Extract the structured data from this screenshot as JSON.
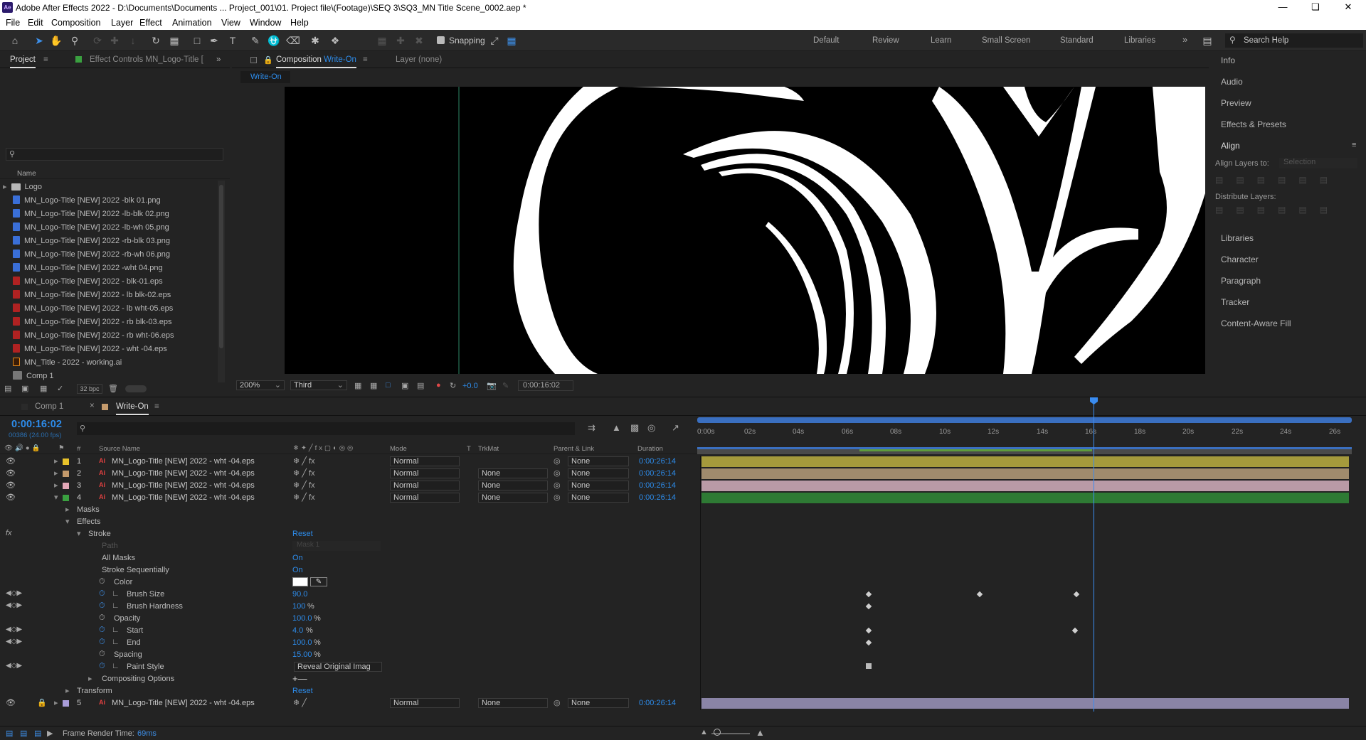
{
  "app": {
    "title": "Adobe After Effects 2022 - D:\\Documents\\Documents ... Project_001\\01. Project file\\(Footage)\\SEQ 3\\SQ3_MN Title Scene_0002.aep *",
    "icon": "Ae"
  },
  "menu": [
    "File",
    "Edit",
    "Composition",
    "Layer",
    "Effect",
    "Animation",
    "View",
    "Window",
    "Help"
  ],
  "toolbar": {
    "snapping": "Snapping",
    "workspaces": [
      "Default",
      "Review",
      "Learn",
      "Small Screen",
      "Standard",
      "Libraries"
    ],
    "search_placeholder": "Search Help",
    "more": "»"
  },
  "project": {
    "tab": "Project",
    "effect_controls_tab": "Effect Controls MN_Logo-Title [",
    "col_name": "Name",
    "bpc": "32 bpc",
    "items": [
      {
        "name": "Logo",
        "type": "folder"
      },
      {
        "name": "MN_Logo-Title [NEW] 2022 -blk 01.png",
        "type": "png"
      },
      {
        "name": "MN_Logo-Title [NEW] 2022 -lb-blk 02.png",
        "type": "png"
      },
      {
        "name": "MN_Logo-Title [NEW] 2022 -lb-wh 05.png",
        "type": "png"
      },
      {
        "name": "MN_Logo-Title [NEW] 2022 -rb-blk 03.png",
        "type": "png"
      },
      {
        "name": "MN_Logo-Title [NEW] 2022 -rb-wh 06.png",
        "type": "png"
      },
      {
        "name": "MN_Logo-Title [NEW] 2022 -wht 04.png",
        "type": "png"
      },
      {
        "name": "MN_Logo-Title [NEW] 2022 - blk-01.eps",
        "type": "eps"
      },
      {
        "name": "MN_Logo-Title [NEW] 2022 - lb blk-02.eps",
        "type": "eps"
      },
      {
        "name": "MN_Logo-Title [NEW] 2022 - lb wht-05.eps",
        "type": "eps"
      },
      {
        "name": "MN_Logo-Title [NEW] 2022 - rb blk-03.eps",
        "type": "eps"
      },
      {
        "name": "MN_Logo-Title [NEW] 2022 - rb wht-06.eps",
        "type": "eps"
      },
      {
        "name": "MN_Logo-Title [NEW] 2022 - wht -04.eps",
        "type": "eps"
      },
      {
        "name": "MN_Title - 2022 - working.ai",
        "type": "ai"
      },
      {
        "name": "Comp 1",
        "type": "comp"
      }
    ]
  },
  "composition": {
    "tab_prefix": "Composition",
    "tab_name": "Write-On",
    "layer_tab": "Layer (none)",
    "breadcrumb": "Write-On",
    "zoom": "200%",
    "resolution": "Third",
    "exposure": "+0.0",
    "timecode": "0:00:16:02"
  },
  "right_panels": [
    "Info",
    "Audio",
    "Preview",
    "Effects & Presets",
    "Align",
    "Libraries",
    "Character",
    "Paragraph",
    "Tracker",
    "Content-Aware Fill"
  ],
  "align": {
    "align_layers_to": "Align Layers to:",
    "selection": "Selection",
    "distribute": "Distribute Layers:"
  },
  "timeline": {
    "tabs": [
      "Comp 1",
      "Write-On"
    ],
    "timecode": "0:00:16:02",
    "fps": "00386 (24.00 fps)",
    "columns": {
      "num": "#",
      "source": "Source Name",
      "mode": "Mode",
      "t": "T",
      "trkmat": "TrkMat",
      "parent": "Parent & Link",
      "duration": "Duration"
    },
    "ruler": [
      "0:00s",
      "02s",
      "04s",
      "06s",
      "08s",
      "10s",
      "12s",
      "14s",
      "16s",
      "18s",
      "20s",
      "22s",
      "24s",
      "26s"
    ],
    "layers": [
      {
        "num": "1",
        "name": "MN_Logo-Title [NEW] 2022 - wht -04.eps",
        "mode": "Normal",
        "trkmat": "",
        "parent": "None",
        "duration": "0:00:26:14",
        "label": "#e8c22a"
      },
      {
        "num": "2",
        "name": "MN_Logo-Title [NEW] 2022 - wht -04.eps",
        "mode": "Normal",
        "trkmat": "None",
        "parent": "None",
        "duration": "0:00:26:14",
        "label": "#c49a6c"
      },
      {
        "num": "3",
        "name": "MN_Logo-Title [NEW] 2022 - wht -04.eps",
        "mode": "Normal",
        "trkmat": "None",
        "parent": "None",
        "duration": "0:00:26:14",
        "label": "#e4a8b8"
      },
      {
        "num": "4",
        "name": "MN_Logo-Title [NEW] 2022 - wht -04.eps",
        "mode": "Normal",
        "trkmat": "None",
        "parent": "None",
        "duration": "0:00:26:14",
        "label": "#3aa040"
      },
      {
        "num": "5",
        "name": "MN_Logo-Title [NEW] 2022 - wht -04.eps",
        "mode": "Normal",
        "trkmat": "None",
        "parent": "None",
        "duration": "0:00:26:14",
        "label": "#a89cd8"
      }
    ],
    "props": {
      "masks": "Masks",
      "effects": "Effects",
      "stroke": "Stroke",
      "reset": "Reset",
      "path": "Path",
      "path_val": "Mask 1",
      "all_masks": "All Masks",
      "all_masks_val": "On",
      "stroke_seq": "Stroke Sequentially",
      "stroke_seq_val": "On",
      "color": "Color",
      "brush_size": "Brush Size",
      "brush_size_val": "90.0",
      "brush_hardness": "Brush Hardness",
      "brush_hardness_val": "100",
      "opacity": "Opacity",
      "opacity_val": "100.0",
      "start": "Start",
      "start_val": "4.0",
      "end": "End",
      "end_val": "100.0",
      "spacing": "Spacing",
      "spacing_val": "15.00",
      "paint_style": "Paint Style",
      "paint_style_val": "Reveal Original Imag",
      "compositing": "Compositing Options",
      "transform": "Transform",
      "transform_reset": "Reset",
      "pct": "%",
      "fx": "fx"
    },
    "footer": {
      "label": "Frame Render Time:",
      "value": "69ms"
    }
  }
}
